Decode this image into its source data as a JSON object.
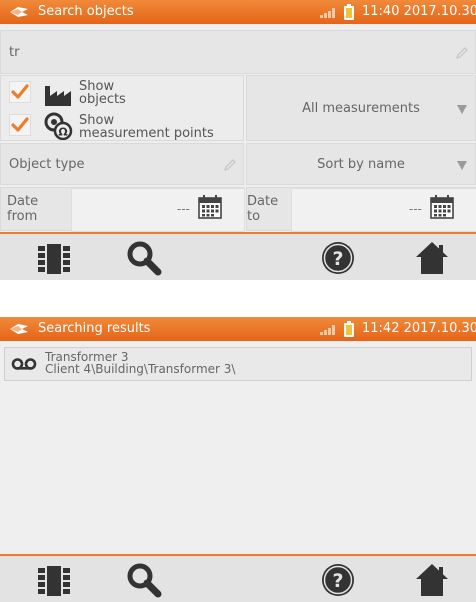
{
  "screen1": {
    "statusbar": {
      "title": "Search objects",
      "time": "11:40 2017.10.30"
    },
    "search_input": {
      "value": "tr"
    },
    "show_objects": {
      "checked": true,
      "label_line1": "Show",
      "label_line2": "objects"
    },
    "show_points": {
      "checked": true,
      "label_line1": "Show",
      "label_line2": "measurement points"
    },
    "measurements_select": {
      "value": "All measurements"
    },
    "object_type_field": {
      "label": "Object type"
    },
    "sort_select": {
      "value": "Sort by name"
    },
    "date_from": {
      "label_line1": "Date",
      "label_line2": "from",
      "value": "---"
    },
    "date_to": {
      "label_line1": "Date",
      "label_line2": "to",
      "value": "---"
    }
  },
  "screen2": {
    "statusbar": {
      "title": "Searching results",
      "time": "11:42 2017.10.30"
    },
    "results": [
      {
        "name": "Transformer 3",
        "path": "Client 4\\Building\\Transformer 3\\",
        "icon": "measurement-point-icon"
      }
    ]
  },
  "toolbar": {
    "buttons": [
      "memory-icon",
      "search-icon",
      "help-icon",
      "home-icon"
    ]
  },
  "colors": {
    "accent": "#e5651a",
    "checkmark": "#f07b2b",
    "icon_dark": "#333333"
  }
}
